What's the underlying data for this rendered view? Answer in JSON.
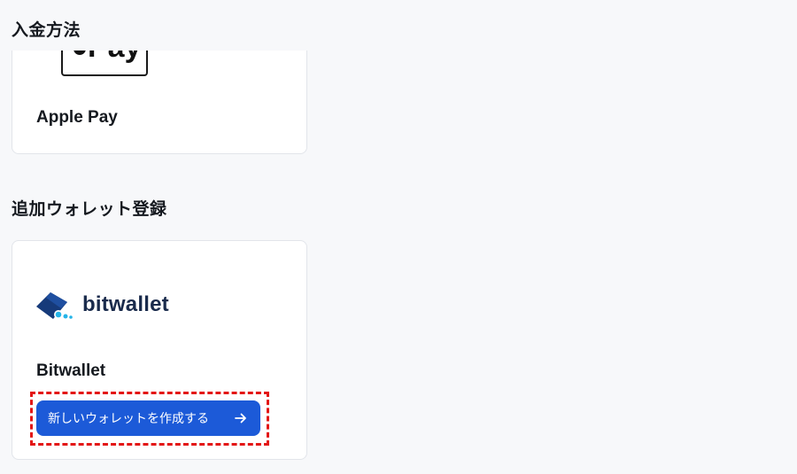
{
  "sections": {
    "deposit_title": "入金方法",
    "wallet_title": "追加ウォレット登録"
  },
  "applepay": {
    "logo_text": "Pay",
    "label": "Apple Pay"
  },
  "bitwallet": {
    "logo_text": "bitwallet",
    "label": "Bitwallet",
    "button_label": "新しいウォレットを作成する",
    "button_icon": "arrow-right-icon",
    "button_color": "#1c5ad8",
    "highlight_color": "#e31616"
  }
}
